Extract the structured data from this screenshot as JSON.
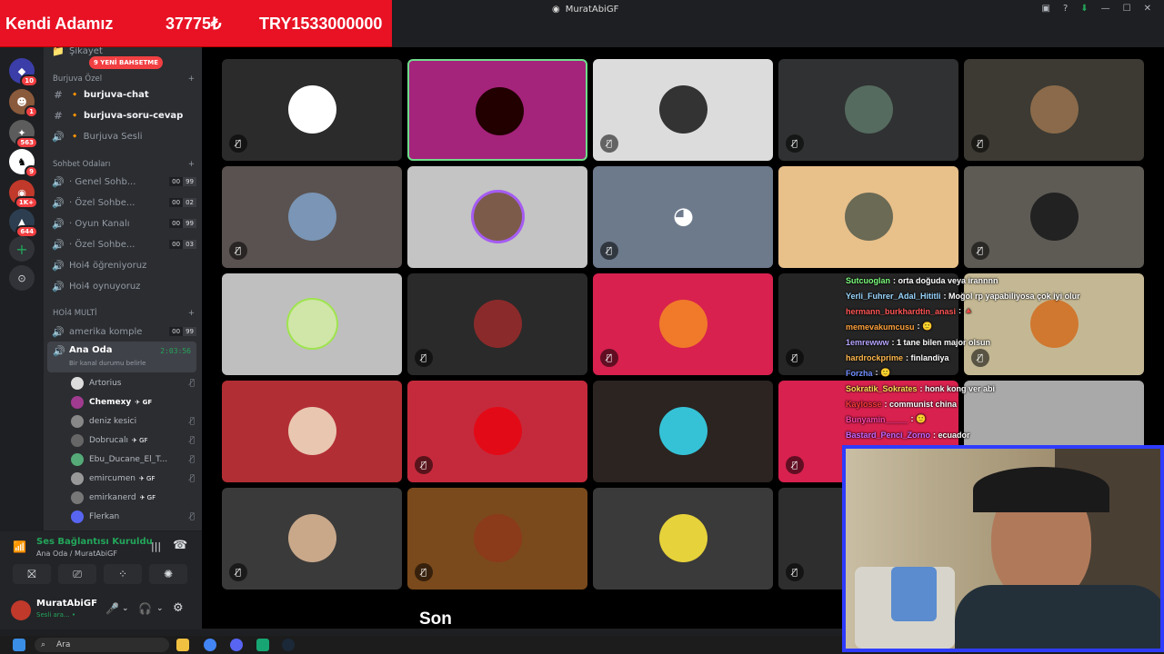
{
  "banner": {
    "name": "Kendi Adamız",
    "amount": "37775₺",
    "total": "TRY1533000000"
  },
  "window": {
    "title": "MuratAbiGF"
  },
  "badge_new": "9 YENİ BAHSETME",
  "servers": [
    {
      "badge": "10"
    },
    {
      "badge": "1"
    },
    {
      "badge": "563"
    },
    {
      "badge": "9"
    },
    {
      "badge": "1K+"
    },
    {
      "badge": "644"
    }
  ],
  "channels": {
    "top_item": "Şikayet",
    "cat1": "Burjuva Özel",
    "text": [
      {
        "label": "burjuva-chat"
      },
      {
        "label": "burjuva-soru-cevap"
      },
      {
        "label": "Burjuva Sesli"
      }
    ],
    "cat2": "Sohbet Odaları",
    "voice": [
      {
        "label": "· Genel Sohb...",
        "a": "00",
        "b": "99"
      },
      {
        "label": "· Özel Sohbe...",
        "a": "00",
        "b": "02"
      },
      {
        "label": "· Oyun Kanalı",
        "a": "00",
        "b": "99"
      },
      {
        "label": "· Özel Sohbe...",
        "a": "00",
        "b": "03"
      }
    ],
    "extra": [
      {
        "label": "Hoi4 öğreniyoruz"
      },
      {
        "label": "Hoi4 oynuyoruz"
      }
    ],
    "cat3": "HOİ4 MULTİ",
    "amerika": {
      "label": "amerika komple",
      "a": "00",
      "b": "99"
    },
    "active": {
      "label": "Ana Oda",
      "time": "2:03:56",
      "status": "Bir kanal durumu belirle"
    },
    "members": [
      {
        "name": "Artorius",
        "tag": ""
      },
      {
        "name": "Chemexy",
        "tag": "✈ GF"
      },
      {
        "name": "deniz kesici",
        "tag": ""
      },
      {
        "name": "Dobrucalı",
        "tag": "✈ GF"
      },
      {
        "name": "Ebu_Ducane_El_T...",
        "tag": ""
      },
      {
        "name": "emircumen",
        "tag": "✈ GF"
      },
      {
        "name": "emirkanerd",
        "tag": "✈ GF"
      },
      {
        "name": "Flerkan",
        "tag": ""
      }
    ]
  },
  "voice_panel": {
    "status": "Ses Bağlantısı Kuruldu",
    "sub": "Ana Oda / MuratAbiGF",
    "user": "MuratAbiGF",
    "user_status": "Sesli ara... •"
  },
  "chat": [
    {
      "user": "Sutcuoglan",
      "color": "#7cfc7c",
      "text": ": orta doğuda veya irannnn"
    },
    {
      "user": "Yerli_Fuhrer_Adal_Hititli",
      "color": "#9ad7ff",
      "text": ": Moğol rp yapabiliyosa çok iyi olur"
    },
    {
      "user": "hermann_burkhardtin_anasi",
      "color": "#ff5555",
      "text": ": 🔺"
    },
    {
      "user": "memevakumcusu",
      "color": "#ffa23c",
      "text": ": 🙂"
    },
    {
      "user": "1emrewww",
      "color": "#b6a4ff",
      "text": ": 1 tane bilen major olsun"
    },
    {
      "user": "hardrockprime",
      "color": "#ffb84d",
      "text": ": finlandiya"
    },
    {
      "user": "Forzha",
      "color": "#6f8cff",
      "text": ": 🙂"
    },
    {
      "user": "Sokratik_Sokrates",
      "color": "#ffdd55",
      "text": ": honk kong ver abi"
    },
    {
      "user": "Kaylosse",
      "color": "#ff3b3b",
      "text": ": communist china"
    },
    {
      "user": "Bunyamin_____",
      "color": "#ff44aa",
      "text": ": 🙂"
    },
    {
      "user": "Bastard_Penci_Zorno",
      "color": "#cc66ff",
      "text": ": ecuador"
    }
  ],
  "subtitle": "Son",
  "taskbar": {
    "search": "Ara"
  }
}
